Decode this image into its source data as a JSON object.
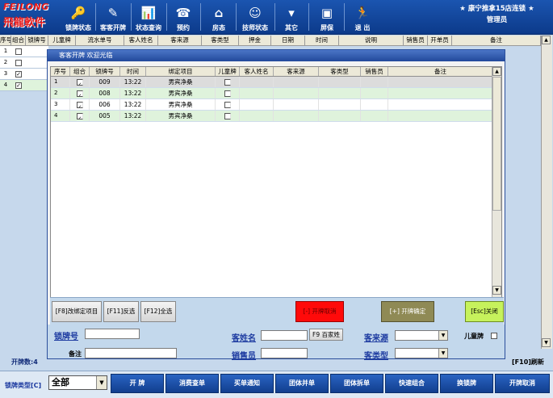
{
  "logo": {
    "top_text": "FEILONG",
    "bottom_text": "飛龍軟件"
  },
  "toolbar": {
    "items": [
      {
        "label": "锁牌状态",
        "icon": "key-icon"
      },
      {
        "label": "客客开牌",
        "icon": "pencil-icon"
      },
      {
        "label": "状态查询",
        "icon": "chart-icon"
      },
      {
        "label": "预约",
        "icon": "phone-icon"
      },
      {
        "label": "房态",
        "icon": "house-icon"
      },
      {
        "label": "技师状态",
        "icon": "technician-icon"
      },
      {
        "label": "其它",
        "icon": "down-arrow-icon"
      },
      {
        "label": "屏保",
        "icon": "screensaver-icon"
      },
      {
        "label": "退 出",
        "icon": "exit-runner-icon"
      }
    ],
    "store_line1": "★ 康宁推拿15店连锁 ★",
    "store_line2": "管理员"
  },
  "main_table": {
    "headers": [
      "序号",
      "组合",
      "锁牌号",
      "儿童牌",
      "流水单号",
      "客人姓名",
      "客来源",
      "客类型",
      "押金",
      "日期",
      "时间",
      "说明",
      "销售员",
      "开单员",
      "备注"
    ],
    "rows": [
      {
        "num": "1",
        "checked": false
      },
      {
        "num": "2",
        "checked": false
      },
      {
        "num": "3",
        "checked": true
      },
      {
        "num": "4",
        "checked": true
      }
    ],
    "count_label": "开牌数:4",
    "refresh_label": "[F10]刷新"
  },
  "dialog": {
    "title": "客客开牌  欢迎光临",
    "headers": [
      "序号",
      "组合",
      "锁牌号",
      "时间",
      "绑定项目",
      "儿童牌",
      "客人姓名",
      "客来源",
      "客类型",
      "销售员",
      "备注"
    ],
    "rows": [
      {
        "num": "1",
        "combo": true,
        "lock": "009",
        "time": "13:22",
        "item": "男宾净桑",
        "child": false
      },
      {
        "num": "2",
        "combo": true,
        "lock": "008",
        "time": "13:22",
        "item": "男宾净桑",
        "child": false
      },
      {
        "num": "3",
        "combo": true,
        "lock": "006",
        "time": "13:22",
        "item": "男宾净桑",
        "child": false
      },
      {
        "num": "4",
        "combo": true,
        "lock": "005",
        "time": "13:22",
        "item": "男宾净桑",
        "child": false
      }
    ],
    "buttons": {
      "change_item": "[F8]改绑定项目",
      "invert": "[F11]反选",
      "select_all": "[F12]全选",
      "cancel_open": "[-] 开牌取消",
      "confirm_open": "[+] 开牌确定",
      "close": "[Esc]关闭"
    },
    "form": {
      "lock_label": "锁牌号",
      "remark_label": "备注",
      "name_label": "客姓名",
      "baijia_button": "F9 百家姓",
      "sales_label": "销售员",
      "source_label": "客来源",
      "type_label": "客类型",
      "child_label": "儿童牌"
    }
  },
  "bottom": {
    "type_label": "锁牌类型[C]",
    "type_value": "全部",
    "buttons": [
      "开 牌",
      "消费查单",
      "买单通知",
      "团体并单",
      "团体拆单",
      "快速组合",
      "换锁牌",
      "开牌取消"
    ]
  }
}
